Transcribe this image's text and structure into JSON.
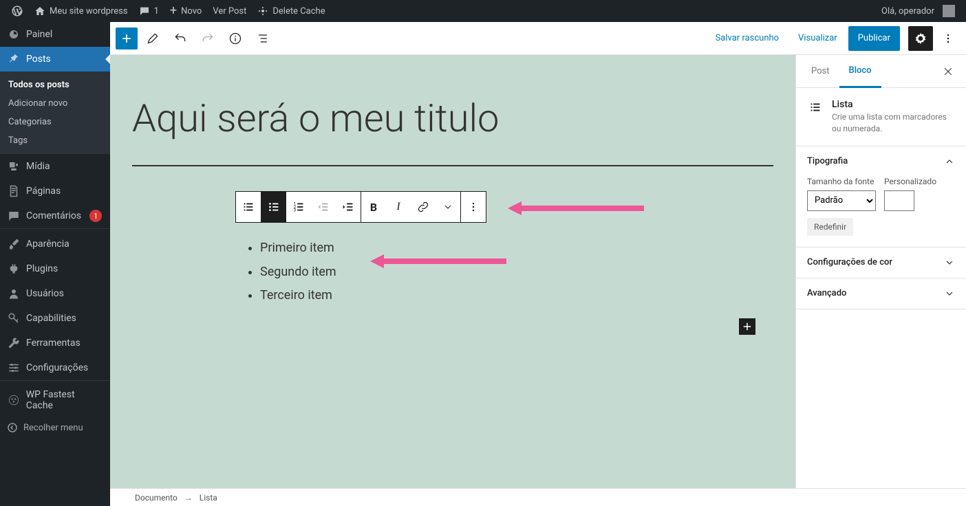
{
  "adminbar": {
    "site_name": "Meu site wordpress",
    "comments_count": "1",
    "new": "Novo",
    "view_post": "Ver Post",
    "delete_cache": "Delete Cache",
    "greeting": "Olá, operador"
  },
  "sidebar": {
    "dashboard": "Painel",
    "posts": "Posts",
    "submenu": {
      "all": "Todos os posts",
      "add": "Adicionar novo",
      "cats": "Categorias",
      "tags": "Tags"
    },
    "media": "Mídia",
    "pages": "Páginas",
    "comments": "Comentários",
    "comments_count": "1",
    "appearance": "Aparência",
    "plugins": "Plugins",
    "users": "Usuários",
    "capabilities": "Capabilities",
    "tools": "Ferramentas",
    "settings": "Configurações",
    "wpfc": "WP Fastest Cache",
    "collapse": "Recolher menu"
  },
  "edbar": {
    "save_draft": "Salvar rascunho",
    "preview": "Visualizar",
    "publish": "Publicar"
  },
  "post": {
    "title": "Aqui será o meu titulo",
    "list_items": [
      "Primeiro item",
      "Segundo item",
      "Terceiro item"
    ]
  },
  "breadcrumb": {
    "doc": "Documento",
    "block": "Lista"
  },
  "inspector": {
    "tab_post": "Post",
    "tab_block": "Bloco",
    "block_title": "Lista",
    "block_desc": "Crie uma lista com marcadores ou numerada.",
    "typography": "Tipografia",
    "font_size": "Tamanho da fonte",
    "custom": "Personalizado",
    "size_value": "Padrão",
    "reset": "Redefinir",
    "color": "Configurações de cor",
    "advanced": "Avançado"
  }
}
